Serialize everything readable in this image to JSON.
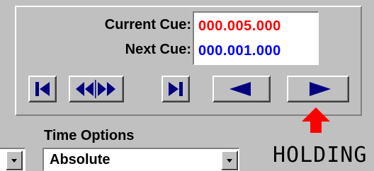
{
  "cue_panel": {
    "current_label": "Current Cue:",
    "current_value": "000.005.000",
    "next_label": "Next Cue:",
    "next_value": "000.001.000"
  },
  "colors": {
    "current_value": "#ff0000",
    "next_value": "#0000ff",
    "button_glyph": "#000080",
    "arrow": "#ff0000"
  },
  "transport": {
    "icons": [
      "skip-to-start-icon",
      "rewind-fast-forward-icon",
      "skip-to-end-icon",
      "step-back-icon",
      "step-forward-icon"
    ]
  },
  "time_options": {
    "title": "Time Options",
    "selected": "Absolute"
  },
  "status": {
    "text": "HOLDING"
  }
}
